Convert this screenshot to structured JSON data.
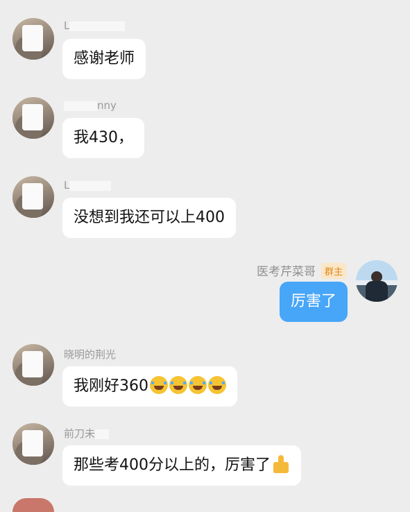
{
  "messages": [
    {
      "name_visible": "L",
      "text": "感谢老师"
    },
    {
      "name_visible": "nny",
      "text": "我430，"
    },
    {
      "name_visible": "L",
      "text": "没想到我还可以上400"
    },
    {
      "sender": "医考芹菜哥",
      "badge": "群主",
      "text": "厉害了"
    },
    {
      "name_visible": "晓明的荆光",
      "text": "我刚好360"
    },
    {
      "name_visible": "前刀未",
      "text": "那些考400分以上的，厉害了"
    }
  ],
  "emoji_icons": [
    "crying-laughing-face",
    "thumbs-up"
  ],
  "colors": {
    "background": "#ededed",
    "bubble_in": "#ffffff",
    "bubble_out": "#47a6f8",
    "badge_text": "#e08a1e"
  }
}
